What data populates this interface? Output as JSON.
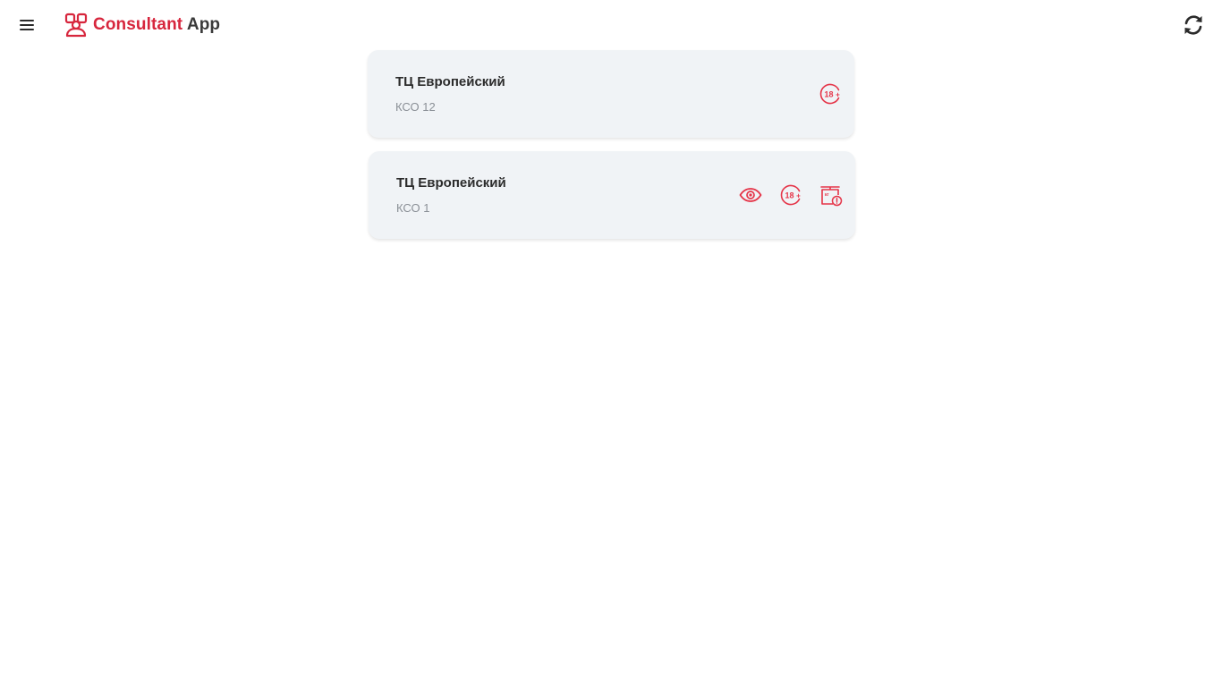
{
  "app": {
    "brand_name": "Consultant",
    "brand_suffix": "App",
    "accent_color": "#d7263d"
  },
  "header": {
    "menu_icon": "hamburger-menu-icon",
    "logo_icon": "consultant-logo-icon",
    "refresh_icon": "refresh-icon"
  },
  "stations": [
    {
      "title": "ТЦ Европейский",
      "subtitle": "КСО 12",
      "status_icons": [
        "age-18-plus-icon"
      ]
    },
    {
      "title": "ТЦ Европейский",
      "subtitle": "КСО 1",
      "status_icons": [
        "eye-icon",
        "age-18-plus-icon",
        "scale-warning-icon"
      ]
    }
  ]
}
